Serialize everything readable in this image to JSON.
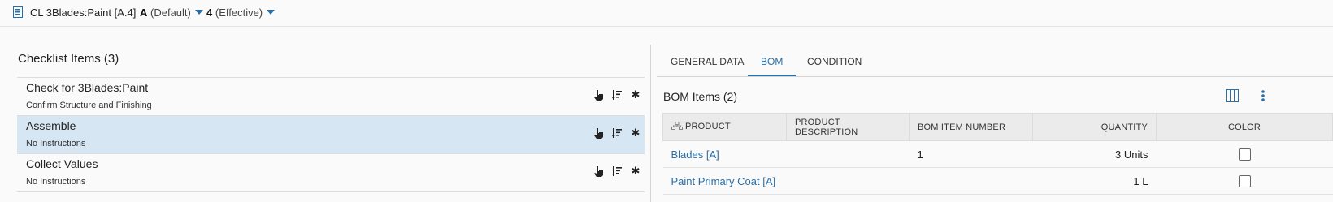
{
  "header": {
    "title": "CL 3Blades:Paint [A.4]",
    "revision": {
      "value": "A",
      "label": "(Default)"
    },
    "effectivity": {
      "value": "4",
      "label": "(Effective)"
    }
  },
  "left": {
    "title": "Checklist Items (3)",
    "items": [
      {
        "name": "Check for 3Blades:Paint",
        "sub": "Confirm Structure and Finishing",
        "selected": false
      },
      {
        "name": "Assemble",
        "sub": "No Instructions",
        "selected": true
      },
      {
        "name": "Collect Values",
        "sub": "No Instructions",
        "selected": false
      }
    ]
  },
  "tabs": [
    {
      "label": "GENERAL DATA"
    },
    {
      "label": "BOM"
    },
    {
      "label": "CONDITION"
    }
  ],
  "bom": {
    "title": "BOM Items (2)",
    "columns": [
      "PRODUCT",
      "PRODUCT DESCRIPTION",
      "BOM ITEM NUMBER",
      "QUANTITY",
      "COLOR"
    ],
    "rows": [
      {
        "product": "Blades [A]",
        "description": "",
        "item_number": "1",
        "quantity": "3 Units",
        "color_checked": false
      },
      {
        "product": "Paint Primary Coat [A]",
        "description": "",
        "item_number": "",
        "quantity": "1 L",
        "color_checked": false
      }
    ]
  },
  "colors": {
    "accent": "#2a6ea6",
    "selected_row": "#d6e6f3"
  },
  "icons": [
    "checklist-icon",
    "hand-pointer-icon",
    "sort-icon",
    "asterisk-icon",
    "columns-icon",
    "more-vertical-icon",
    "move-handle-icon"
  ]
}
